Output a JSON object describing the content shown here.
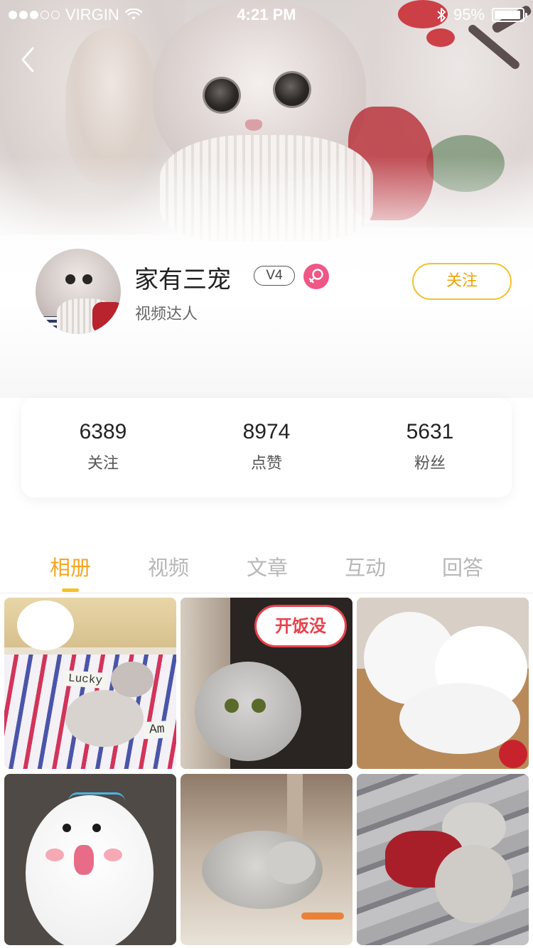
{
  "status_bar": {
    "carrier": "VIRGIN",
    "time": "4:21 PM",
    "battery": "95%",
    "battery_level": 0.95,
    "signal_bars_filled": 3,
    "signal_bars_total": 5
  },
  "profile": {
    "name": "家有三宠",
    "level": "V4",
    "subtitle": "视频达人",
    "follow_label": "关注",
    "gender_icon": "female-icon"
  },
  "stats": [
    {
      "value": "6389",
      "label": "关注"
    },
    {
      "value": "8974",
      "label": "点赞"
    },
    {
      "value": "5631",
      "label": "粉丝"
    }
  ],
  "tabs": [
    {
      "label": "相册",
      "active": true
    },
    {
      "label": "视频",
      "active": false
    },
    {
      "label": "文章",
      "active": false
    },
    {
      "label": "互动",
      "active": false
    },
    {
      "label": "回答",
      "active": false
    }
  ],
  "photos": {
    "sticker_text": "开饭没",
    "card_lucky": "Lucky",
    "card_am": "Am"
  },
  "colors": {
    "accent": "#f5a623",
    "follow_border": "#f5c22a",
    "gender_badge": "#f05686"
  }
}
